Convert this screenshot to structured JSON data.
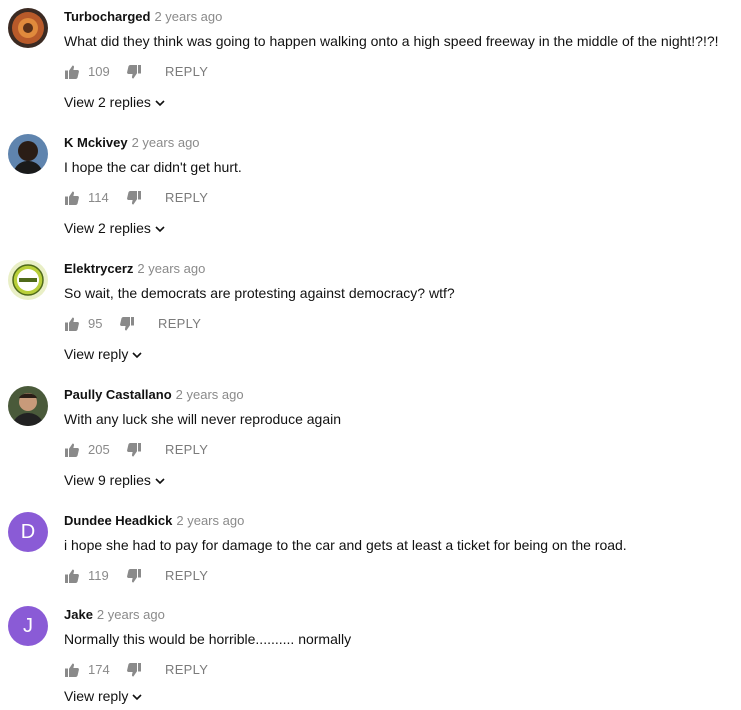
{
  "reply_label": "REPLY",
  "comments": [
    {
      "author": "Turbocharged",
      "time": "2 years ago",
      "text": "What did they think was going to happen walking onto a high speed freeway in the middle of the night!?!?!",
      "likes": "109",
      "replies": "View 2 replies",
      "avatar_icon": "turbo-avatar"
    },
    {
      "author": "K Mckivey",
      "time": "2 years ago",
      "text": "I hope the car didn't get hurt.",
      "likes": "114",
      "replies": "View 2 replies",
      "avatar_icon": "person-avatar"
    },
    {
      "author": "Elektrycerz",
      "time": "2 years ago",
      "text": "So wait, the democrats are protesting against democracy? wtf?",
      "likes": "95",
      "replies": "View reply",
      "avatar_icon": "emblem-avatar"
    },
    {
      "author": "Paully Castallano",
      "time": "2 years ago",
      "text": "With any luck she will never reproduce again",
      "likes": "205",
      "replies": "View 9 replies",
      "avatar_icon": "person-avatar"
    },
    {
      "author": "Dundee Headkick",
      "time": "2 years ago",
      "text": "i hope she had to pay for damage to the car and gets at least a ticket for being on the road.",
      "likes": "119",
      "replies": "",
      "avatar_letter": "D",
      "avatar_color": "#8a5bd6"
    },
    {
      "author": "Jake",
      "time": "2 years ago",
      "text": "Normally this would be horrible.......... normally",
      "likes": "174",
      "replies": "View reply",
      "avatar_letter": "J",
      "avatar_color": "#8a5bd6"
    }
  ]
}
